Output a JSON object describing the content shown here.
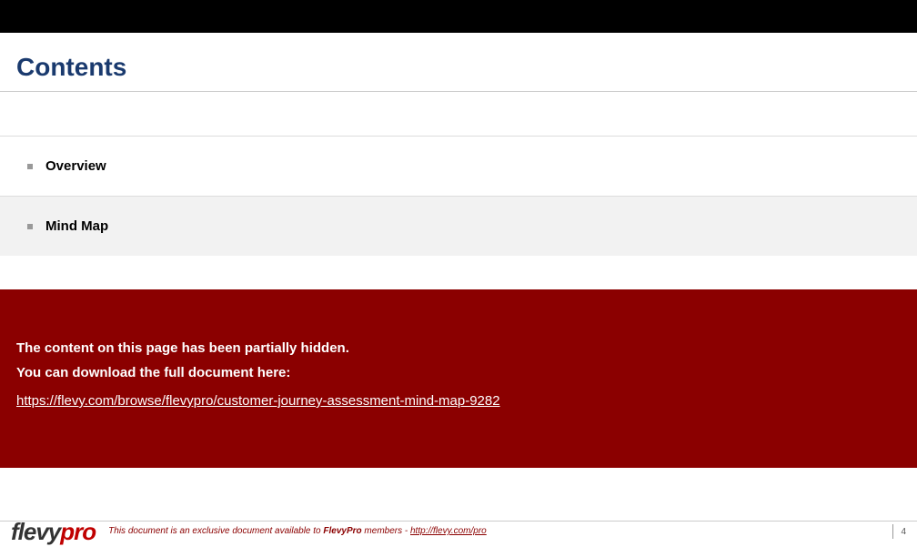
{
  "header": {
    "title": "Contents"
  },
  "items": [
    {
      "label": "Overview"
    },
    {
      "label": "Mind Map"
    }
  ],
  "hidden": {
    "line1": "The content on this page has been partially hidden.",
    "line2": "You can download the full document here:",
    "link_text": "https://flevy.com/browse/flevypro/customer-journey-assessment-mind-map-9282",
    "link_href": "https://flevy.com/browse/flevypro/customer-journey-assessment-mind-map-9282"
  },
  "footer": {
    "logo_part1": "flevy",
    "logo_part2": "pro",
    "text_prefix": "This document is an exclusive document available to ",
    "text_bold": "FlevyPro",
    "text_suffix": " members - ",
    "link_text": "http://flevy.com/pro",
    "link_href": "http://flevy.com/pro"
  },
  "page_number": "4"
}
